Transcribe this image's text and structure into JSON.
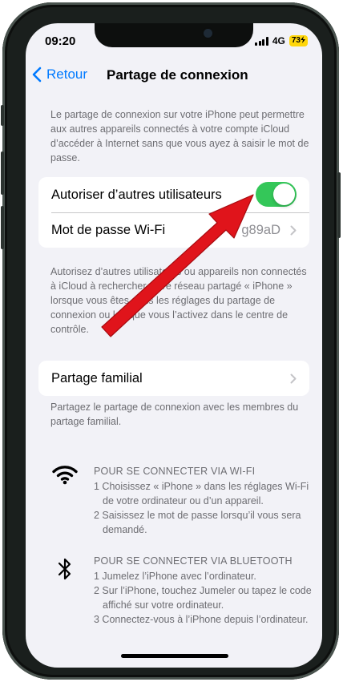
{
  "status_bar": {
    "time": "09:20",
    "network": "4G",
    "battery": "73"
  },
  "nav": {
    "back_label": "Retour",
    "title": "Partage de connexion"
  },
  "intro_text": "Le partage de connexion sur votre iPhone peut permettre aux autres appareils connectés à votre compte iCloud d’accéder à Internet sans que vous ayez à saisir le mot de passe.",
  "settings": {
    "allow_others_label": "Autoriser d’autres utilisateurs",
    "allow_others_enabled": true,
    "wifi_password_label": "Mot de passe Wi-Fi",
    "wifi_password_value": "g89aD"
  },
  "allow_footnote": "Autorisez d’autres utilisateurs ou appareils non connectés à iCloud à rechercher votre réseau partagé « iPhone » lorsque vous êtes dans les réglages du partage de connexion ou lorsque vous l’activez dans le centre de contrôle.",
  "family": {
    "label": "Partage familial",
    "footnote": "Partagez le partage de connexion avec les membres du partage familial."
  },
  "wifi_instructions": {
    "icon": "wifi-icon",
    "heading": "POUR SE CONNECTER VIA WI-FI",
    "step1": "1 Choisissez « iPhone » dans les réglages Wi-Fi de votre ordinateur ou d’un appareil.",
    "step2": "2 Saisissez le mot de passe lorsqu’il vous sera demandé."
  },
  "bluetooth_instructions": {
    "icon": "bluetooth-icon",
    "heading": "POUR SE CONNECTER VIA BLUETOOTH",
    "step1": "1 Jumelez l’iPhone avec l’ordinateur.",
    "step2": "2 Sur l’iPhone, touchez Jumeler ou tapez le code affiché sur votre ordinateur.",
    "step3": "3 Connectez-vous à l’iPhone depuis l’ordinateur."
  },
  "colors": {
    "accent": "#007aff",
    "toggle_on": "#34c759",
    "annotation_arrow": "#e0141b",
    "background": "#f2f2f7"
  }
}
